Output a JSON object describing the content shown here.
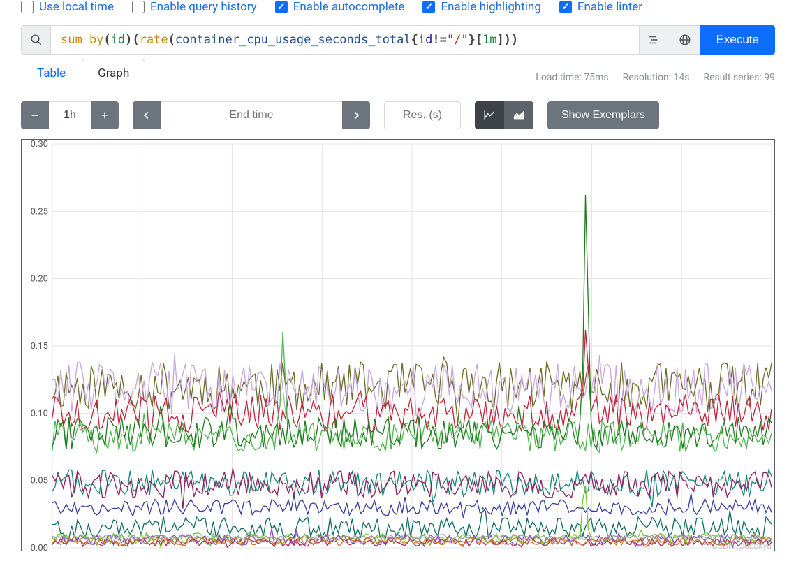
{
  "options": [
    {
      "key": "local_time",
      "label": "Use local time",
      "checked": false
    },
    {
      "key": "history",
      "label": "Enable query history",
      "checked": false
    },
    {
      "key": "autocomplete",
      "label": "Enable autocomplete",
      "checked": true
    },
    {
      "key": "highlighting",
      "label": "Enable highlighting",
      "checked": true
    },
    {
      "key": "linter",
      "label": "Enable linter",
      "checked": true
    }
  ],
  "query": {
    "tokens": [
      {
        "t": "kw",
        "v": "sum by"
      },
      {
        "t": "sp",
        "v": " "
      },
      {
        "t": "pn",
        "v": "("
      },
      {
        "t": "id",
        "v": "id"
      },
      {
        "t": "pn",
        "v": ")"
      },
      {
        "t": "sp",
        "v": " "
      },
      {
        "t": "pn",
        "v": "("
      },
      {
        "t": "fn",
        "v": "rate"
      },
      {
        "t": "sp",
        "v": " "
      },
      {
        "t": "pn",
        "v": "("
      },
      {
        "t": "mt",
        "v": "container_cpu_usage_seconds_total"
      },
      {
        "t": "pn",
        "v": "{"
      },
      {
        "t": "lbl",
        "v": "id"
      },
      {
        "t": "pn",
        "v": "!="
      },
      {
        "t": "str",
        "v": "\"/\""
      },
      {
        "t": "pn",
        "v": "}"
      },
      {
        "t": "pn",
        "v": "["
      },
      {
        "t": "num",
        "v": "1m"
      },
      {
        "t": "pn",
        "v": "]"
      },
      {
        "t": "pn",
        "v": ")"
      },
      {
        "t": "pn",
        "v": ")"
      }
    ],
    "raw": "sum by (id) (rate (container_cpu_usage_seconds_total{id!=\"/\"}[1m]))"
  },
  "execute_label": "Execute",
  "tabs": {
    "table": "Table",
    "graph": "Graph",
    "active": "graph"
  },
  "stats": {
    "load_time": "Load time: 75ms",
    "resolution": "Resolution: 14s",
    "series": "Result series: 99"
  },
  "controls": {
    "range_value": "1h",
    "end_time_placeholder": "End time",
    "resolution_placeholder": "Res. (s)",
    "show_exemplars": "Show Exemplars"
  },
  "watermark": "CSDN @ucbkyu",
  "chart_data": {
    "type": "line",
    "xlabel": "",
    "ylabel": "",
    "ylim": [
      0.0,
      0.3
    ],
    "yticks": [
      0.0,
      0.05,
      0.1,
      0.15,
      0.2,
      0.25,
      0.3
    ],
    "x_points": 260,
    "series": [
      {
        "name": "olive",
        "color": "#6b6b2b",
        "base": 0.12,
        "amp": 0.018,
        "spike_at": null,
        "spike_h": 0
      },
      {
        "name": "plum",
        "color": "#caa5da",
        "base": 0.118,
        "amp": 0.02,
        "spike_at": null,
        "spike_h": 0
      },
      {
        "name": "crimson",
        "color": "#c0223a",
        "base": 0.1,
        "amp": 0.014,
        "spike_at": 0.742,
        "spike_h": 0.07
      },
      {
        "name": "green-mid",
        "color": "#4fb64f",
        "base": 0.083,
        "amp": 0.012,
        "spike_at": 0.321,
        "spike_h": 0.085
      },
      {
        "name": "green-dark",
        "color": "#1e7a1e",
        "base": 0.085,
        "amp": 0.012,
        "spike_at": 0.742,
        "spike_h": 0.2
      },
      {
        "name": "teal",
        "color": "#1b8278",
        "base": 0.048,
        "amp": 0.01,
        "spike_at": null,
        "spike_h": 0
      },
      {
        "name": "magenta",
        "color": "#8b1f63",
        "base": 0.047,
        "amp": 0.01,
        "spike_at": null,
        "spike_h": 0
      },
      {
        "name": "indigo",
        "color": "#3b3b9e",
        "base": 0.03,
        "amp": 0.006,
        "spike_at": null,
        "spike_h": 0
      },
      {
        "name": "teal-low",
        "color": "#0f6b64",
        "base": 0.015,
        "amp": 0.008,
        "spike_at": 0.6,
        "spike_h": 0.02
      },
      {
        "name": "lime",
        "color": "#71c837",
        "base": 0.007,
        "amp": 0.004,
        "spike_at": 0.74,
        "spike_h": 0.05
      },
      {
        "name": "purple-low",
        "color": "#8a45c2",
        "base": 0.006,
        "amp": 0.004,
        "spike_at": null,
        "spike_h": 0
      },
      {
        "name": "red-low",
        "color": "#b0304a",
        "base": 0.004,
        "amp": 0.003,
        "spike_at": null,
        "spike_h": 0
      },
      {
        "name": "grey-low",
        "color": "#9a9a9a",
        "base": 0.008,
        "amp": 0.002,
        "spike_at": null,
        "spike_h": 0
      },
      {
        "name": "orange-low",
        "color": "#c77a2b",
        "base": 0.005,
        "amp": 0.003,
        "spike_at": null,
        "spike_h": 0
      }
    ],
    "seed": 11
  }
}
